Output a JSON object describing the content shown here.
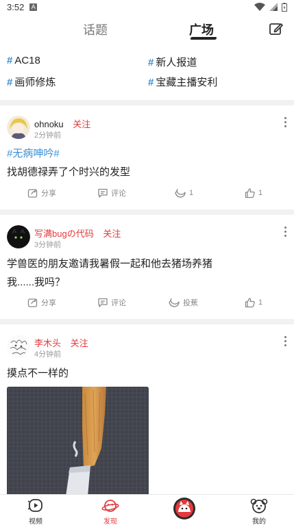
{
  "status_bar": {
    "time": "3:52",
    "notif_badge": "A"
  },
  "top_nav": {
    "tabs": [
      {
        "label": "话题"
      },
      {
        "label": "广场"
      }
    ]
  },
  "topics": [
    {
      "label": "AC18"
    },
    {
      "label": "新人报道"
    },
    {
      "label": "画师修炼"
    },
    {
      "label": "宝藏主播安利"
    }
  ],
  "posts": [
    {
      "author": "ohnoku",
      "follow_label": "关注",
      "time": "2分钟前",
      "tag": "#无病呻吟#",
      "lines": [
        "找胡德禄弄了个时兴的发型"
      ],
      "actions": {
        "share": "分享",
        "comment": "评论",
        "third": "1",
        "like": "1"
      }
    },
    {
      "author": "写满bugの代码",
      "follow_label": "关注",
      "time": "3分钟前",
      "lines": [
        "学兽医的朋友邀请我暑假一起和他去猪场养猪",
        "我......我吗？"
      ],
      "actions": {
        "share": "分享",
        "comment": "评论",
        "third": "投蕉",
        "like": "1"
      }
    },
    {
      "author": "李木头",
      "follow_label": "关注",
      "time": "4分钟前",
      "lines": [
        "摸点不一样的"
      ]
    }
  ],
  "bottom_nav": {
    "items": [
      {
        "label": "视频"
      },
      {
        "label": "发现"
      },
      {
        "label": ""
      },
      {
        "label": "我的"
      }
    ]
  },
  "colors": {
    "accent": "#e4393c",
    "topic_hash": "#3a8fd6",
    "divider": "#f1f1f1"
  }
}
